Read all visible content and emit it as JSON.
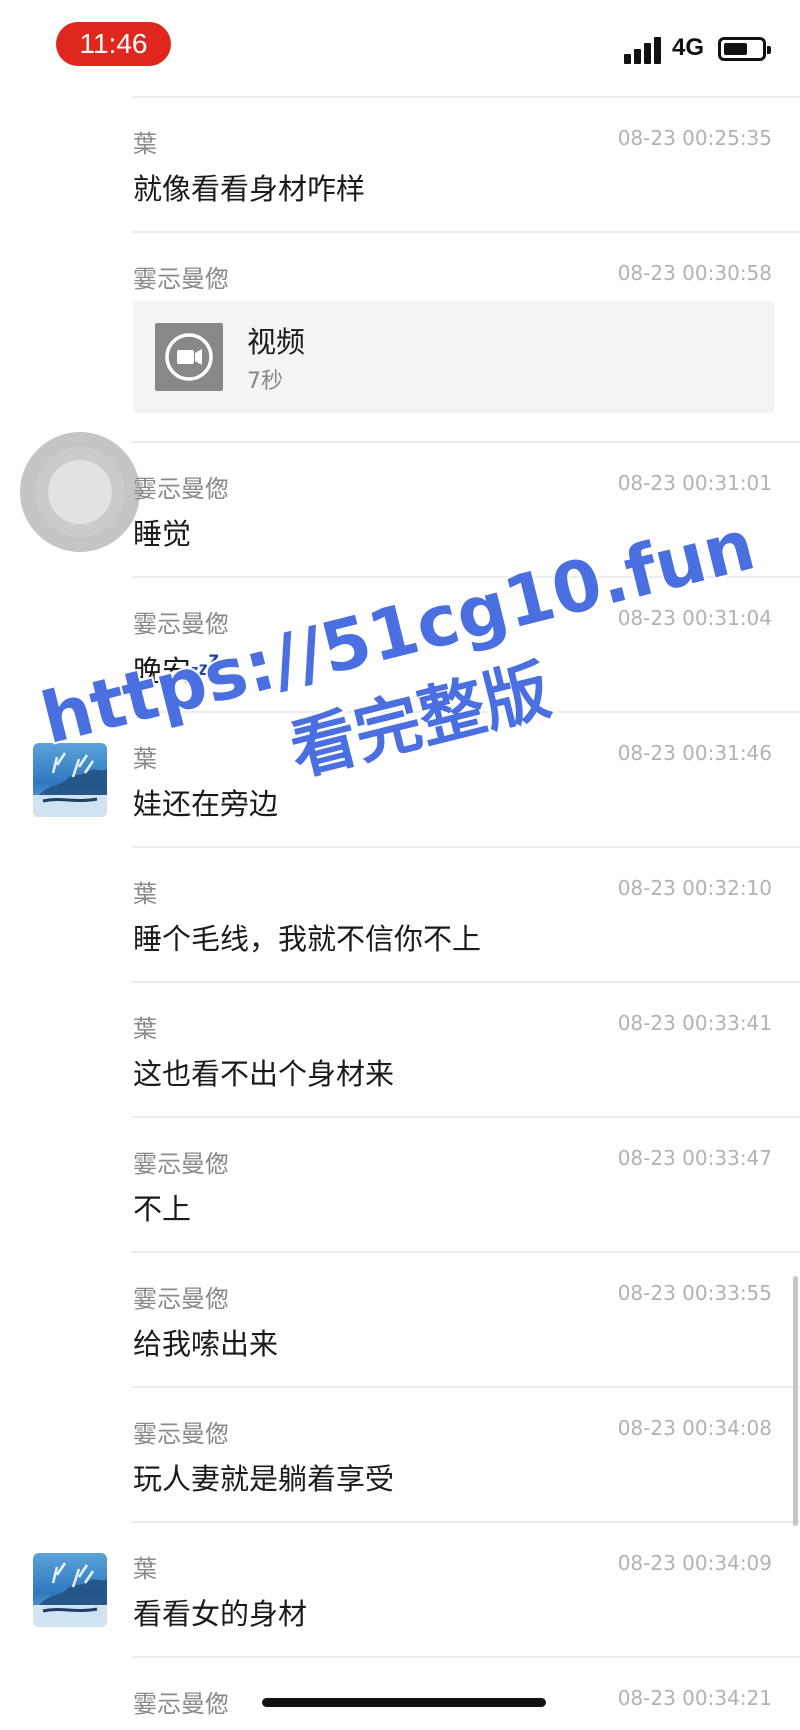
{
  "status_bar": {
    "time": "11:46",
    "network": "4G",
    "battery_level": 0.6
  },
  "messages": [
    {
      "sender": "葉",
      "time": "08-23 00:25:35",
      "text": "就像看看身材咋样",
      "avatar": false
    },
    {
      "sender": "霎忈曼偬",
      "time": "08-23 00:30:58",
      "type": "video",
      "video_title": "视频",
      "video_duration": "7秒"
    },
    {
      "sender": "霎忈曼偬",
      "time": "08-23 00:31:01",
      "text": "睡觉"
    },
    {
      "sender": "霎忈曼偬",
      "time": "08-23 00:31:04",
      "text": "晚安",
      "emoji": "zzz-icon"
    },
    {
      "sender": "葉",
      "time": "08-23 00:31:46",
      "text": "娃还在旁边",
      "avatar": true
    },
    {
      "sender": "葉",
      "time": "08-23 00:32:10",
      "text": "睡个毛线，我就不信你不上"
    },
    {
      "sender": "葉",
      "time": "08-23 00:33:41",
      "text": "这也看不出个身材来"
    },
    {
      "sender": "霎忈曼偬",
      "time": "08-23 00:33:47",
      "text": "不上"
    },
    {
      "sender": "霎忈曼偬",
      "time": "08-23 00:33:55",
      "text": "给我嗦出来"
    },
    {
      "sender": "霎忈曼偬",
      "time": "08-23 00:34:08",
      "text": "玩人妻就是躺着享受"
    },
    {
      "sender": "葉",
      "time": "08-23 00:34:09",
      "text": "看看女的身材",
      "avatar": true
    },
    {
      "sender": "霎忈曼偬",
      "time": "08-23 00:34:21",
      "text": ""
    }
  ],
  "watermark": {
    "line1": "https://51cg10.fun",
    "line2": "看完整版",
    "color": "#4a6fe0"
  },
  "colors": {
    "time_pill": "#e0271e",
    "divider": "#ececec",
    "sender": "#8a8a8a",
    "timestamp": "#b2b2b2"
  }
}
